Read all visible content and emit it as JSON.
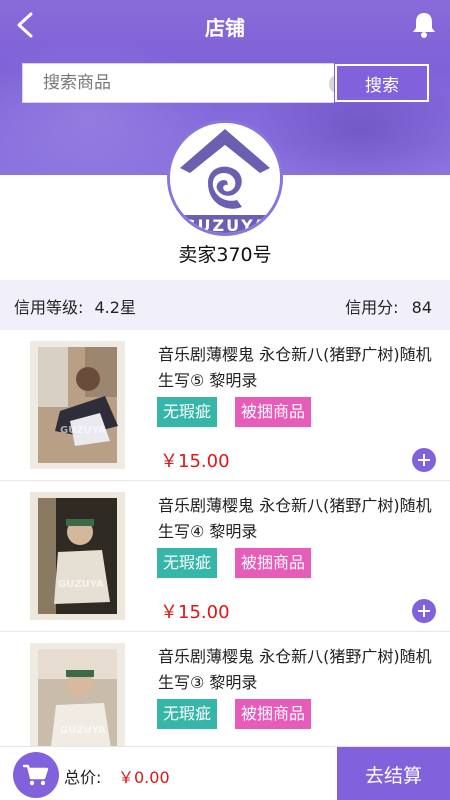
{
  "header": {
    "title": "店铺",
    "back_icon": "chevron-left-icon",
    "bell_icon": "bell-icon"
  },
  "search": {
    "placeholder": "搜索商品",
    "clear_icon": "clear-icon",
    "clear_glyph": "×",
    "button": "搜索"
  },
  "shop": {
    "name": "卖家370号",
    "logo_text": "GUZUYA"
  },
  "credit": {
    "level_label": "信用等级:",
    "level_value": "4.2星",
    "score_label": "信用分:",
    "score_value": "84"
  },
  "products": [
    {
      "name": "音乐剧薄樱鬼 永仓新八(猪野广树)随机生写⑤ 黎明录",
      "tag1": "无瑕疵",
      "tag2": "被捆商品",
      "price": "￥15.00",
      "watermark": "GUZUYA"
    },
    {
      "name": "音乐剧薄樱鬼 永仓新八(猪野广树)随机生写④ 黎明录",
      "tag1": "无瑕疵",
      "tag2": "被捆商品",
      "price": "￥15.00",
      "watermark": "GUZUYA"
    },
    {
      "name": "音乐剧薄樱鬼 永仓新八(猪野广树)随机生写③ 黎明录",
      "tag1": "无瑕疵",
      "tag2": "被捆商品",
      "price": "",
      "watermark": "GUZUYA"
    }
  ],
  "footer": {
    "total_label": "总价:",
    "total_value": "￥0.00",
    "checkout": "去结算",
    "cart_icon": "cart-icon"
  },
  "colors": {
    "primary": "#8162dc",
    "price": "#e11616",
    "tag_teal": "#35b6a8",
    "tag_pink": "#e65cb9",
    "credit_bg": "#f1eff9"
  }
}
